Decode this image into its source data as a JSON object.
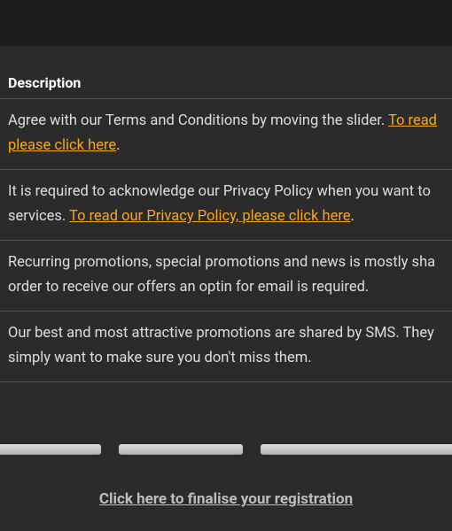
{
  "header": {
    "description_label": "Description"
  },
  "rows": {
    "terms": {
      "text_before": "Agree with our Terms and Conditions by moving the slider. ",
      "link": "To read please click here",
      "text_after": "."
    },
    "privacy": {
      "text_before": "It is required to acknowledge our Privacy Policy when you want to services. ",
      "link": "To read our Privacy Policy, please click here",
      "text_after": "."
    },
    "promotions": {
      "text": "Recurring promotions, special promotions and news is mostly sha order to receive our offers an optin for email is required."
    },
    "sms": {
      "text": "Our best and most attractive promotions are shared by SMS. They simply want to make sure you don't miss them."
    }
  },
  "finalise_link": "Click here to finalise your registration"
}
